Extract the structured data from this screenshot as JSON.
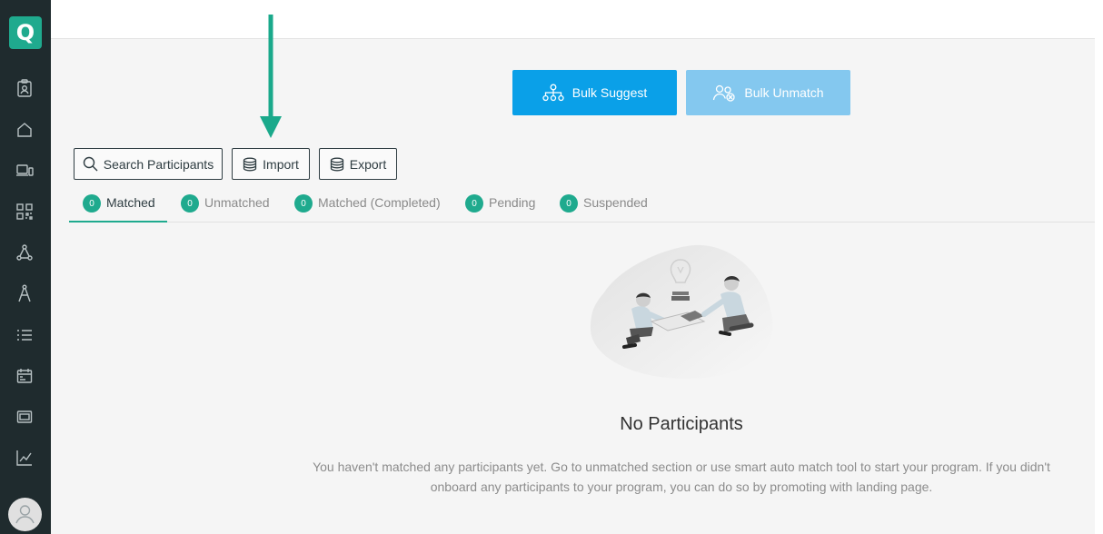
{
  "app": {
    "logo_letter": "Q"
  },
  "sidebar": {
    "items": [
      {
        "icon": "id-badge-icon"
      },
      {
        "icon": "home-icon"
      },
      {
        "icon": "devices-icon"
      },
      {
        "icon": "qr-grid-icon"
      },
      {
        "icon": "network-icon"
      },
      {
        "icon": "compass-tool-icon"
      },
      {
        "icon": "list-icon"
      },
      {
        "icon": "calendar-icon"
      },
      {
        "icon": "card-icon"
      },
      {
        "icon": "chart-icon"
      }
    ],
    "avatar_icon": "user-avatar-icon"
  },
  "toolbar": {
    "bulk_suggest_label": "Bulk Suggest",
    "bulk_unmatch_label": "Bulk Unmatch",
    "search_label": "Search Participants",
    "import_label": "Import",
    "export_label": "Export"
  },
  "tabs": [
    {
      "count": "0",
      "label": "Matched",
      "active": true
    },
    {
      "count": "0",
      "label": "Unmatched",
      "active": false
    },
    {
      "count": "0",
      "label": "Matched (Completed)",
      "active": false
    },
    {
      "count": "0",
      "label": "Pending",
      "active": false
    },
    {
      "count": "0",
      "label": "Suspended",
      "active": false
    }
  ],
  "empty_state": {
    "title": "No Participants",
    "description": "You haven't matched any participants yet. Go to unmatched section or use smart auto match tool to start your program. If you didn't onboard any participants to your program, you can do so by promoting with landing page."
  },
  "colors": {
    "accent": "#1faa8e",
    "primary_blue": "#0aa0e8",
    "disabled_blue": "#84c8ef",
    "sidebar_bg": "#1f2b2e"
  }
}
